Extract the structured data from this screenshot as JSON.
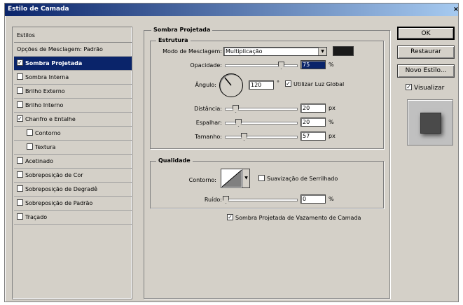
{
  "window": {
    "title": "Estilo de Camada",
    "close_glyph": "×"
  },
  "sidebar": {
    "header": "Estilos",
    "items": [
      {
        "label": "Opções de Mesclagem: Padrão",
        "checkbox": false,
        "checked": false,
        "selected": false
      },
      {
        "label": "Sombra Projetada",
        "checkbox": true,
        "checked": true,
        "selected": true
      },
      {
        "label": "Sombra Interna",
        "checkbox": true,
        "checked": false,
        "selected": false
      },
      {
        "label": "Brilho Externo",
        "checkbox": true,
        "checked": false,
        "selected": false
      },
      {
        "label": "Brilho Interno",
        "checkbox": true,
        "checked": false,
        "selected": false
      },
      {
        "label": "Chanfro e Entalhe",
        "checkbox": true,
        "checked": true,
        "selected": false
      },
      {
        "label": "Contorno",
        "checkbox": true,
        "checked": false,
        "selected": false
      },
      {
        "label": "Textura",
        "checkbox": true,
        "checked": false,
        "selected": false
      },
      {
        "label": "Acetinado",
        "checkbox": true,
        "checked": false,
        "selected": false
      },
      {
        "label": "Sobreposição de Cor",
        "checkbox": true,
        "checked": false,
        "selected": false
      },
      {
        "label": "Sobreposição de Degradê",
        "checkbox": true,
        "checked": false,
        "selected": false
      },
      {
        "label": "Sobreposição de Padrão",
        "checkbox": true,
        "checked": false,
        "selected": false
      },
      {
        "label": "Traçado",
        "checkbox": true,
        "checked": false,
        "selected": false
      }
    ]
  },
  "main": {
    "section_title": "Sombra Projetada",
    "structure": {
      "title": "Estrutura",
      "blend_mode_label": "Modo de Mesclagem:",
      "blend_mode_value": "Multiplicação",
      "opacity_label": "Opacidade:",
      "opacity_value": "75",
      "opacity_unit": "%",
      "angle_label": "Ângulo:",
      "angle_value": "120",
      "angle_unit": "°",
      "global_light_label": "Utilizar Luz Global",
      "distance_label": "Distância:",
      "distance_value": "20",
      "distance_unit": "px",
      "spread_label": "Espalhar:",
      "spread_value": "20",
      "spread_unit": "%",
      "size_label": "Tamanho:",
      "size_value": "57",
      "size_unit": "px"
    },
    "quality": {
      "title": "Qualidade",
      "contour_label": "Contorno:",
      "antialias_label": "Suavização de Serrilhado",
      "noise_label": "Ruído:",
      "noise_value": "0",
      "noise_unit": "%"
    },
    "knockout_label": "Sombra Projetada de Vazamento de Camada"
  },
  "buttons": {
    "ok": "OK",
    "reset": "Restaurar",
    "new_style": "Novo Estilo...",
    "preview": "Visualizar"
  },
  "colors": {
    "accent": "#0a246a",
    "shadow_swatch": "#1a1a1a",
    "preview_swatch": "#4a4a4a"
  }
}
